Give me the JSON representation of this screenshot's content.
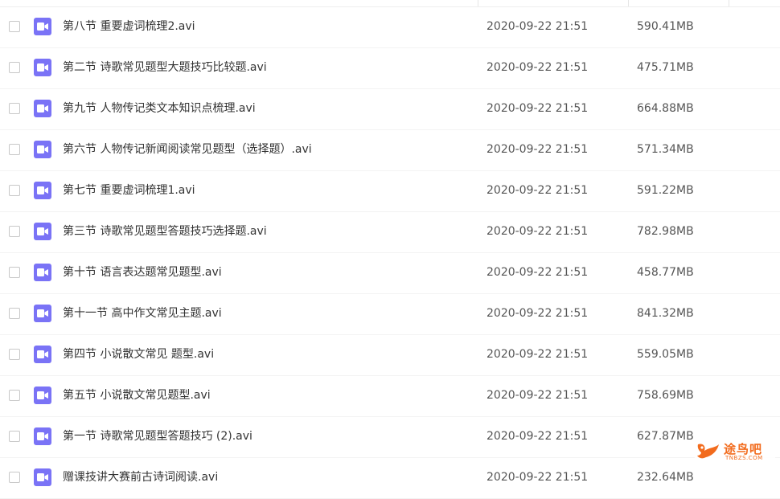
{
  "files": [
    {
      "name": "第八节 重要虚词梳理2.avi",
      "date": "2020-09-22 21:51",
      "size": "590.41MB"
    },
    {
      "name": "第二节 诗歌常见题型大题技巧比较题.avi",
      "date": "2020-09-22 21:51",
      "size": "475.71MB"
    },
    {
      "name": "第九节 人物传记类文本知识点梳理.avi",
      "date": "2020-09-22 21:51",
      "size": "664.88MB"
    },
    {
      "name": "第六节 人物传记新闻阅读常见题型（选择题）.avi",
      "date": "2020-09-22 21:51",
      "size": "571.34MB"
    },
    {
      "name": "第七节 重要虚词梳理1.avi",
      "date": "2020-09-22 21:51",
      "size": "591.22MB"
    },
    {
      "name": "第三节 诗歌常见题型答题技巧选择题.avi",
      "date": "2020-09-22 21:51",
      "size": "782.98MB"
    },
    {
      "name": "第十节 语言表达题常见题型.avi",
      "date": "2020-09-22 21:51",
      "size": "458.77MB"
    },
    {
      "name": "第十一节 高中作文常见主题.avi",
      "date": "2020-09-22 21:51",
      "size": "841.32MB"
    },
    {
      "name": "第四节 小说散文常见 题型.avi",
      "date": "2020-09-22 21:51",
      "size": "559.05MB"
    },
    {
      "name": "第五节 小说散文常见题型.avi",
      "date": "2020-09-22 21:51",
      "size": "758.69MB"
    },
    {
      "name": "第一节 诗歌常见题型答题技巧 (2).avi",
      "date": "2020-09-22 21:51",
      "size": "627.87MB"
    },
    {
      "name": "赠课技讲大赛前古诗词阅读.avi",
      "date": "2020-09-22 21:51",
      "size": "232.64MB"
    }
  ],
  "watermark": {
    "text": "途鸟吧",
    "subtext": "TNBZS.COM"
  },
  "colors": {
    "video_icon": "#7a73f6",
    "watermark": "#f26b1d"
  },
  "icons": {
    "file_type": "video-camera-icon",
    "watermark_logo": "bird-logo-icon"
  }
}
